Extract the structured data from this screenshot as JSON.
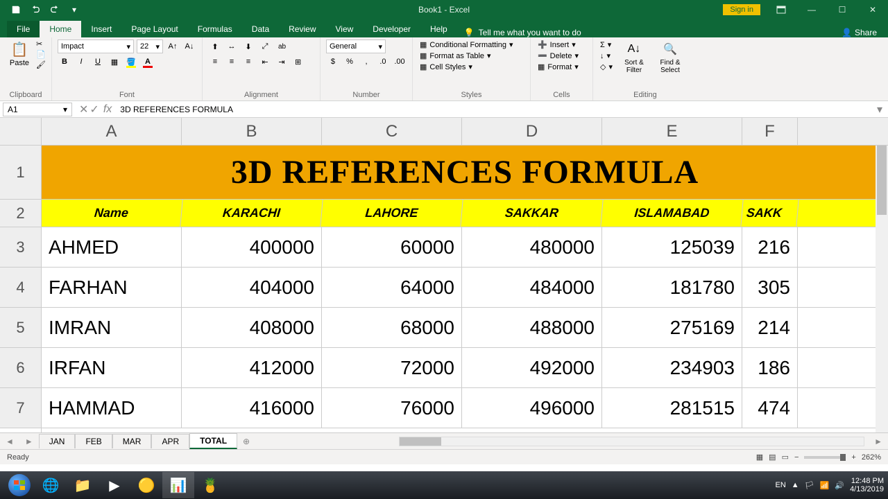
{
  "app": {
    "title": "Book1 - Excel"
  },
  "titlebar": {
    "signin": "Sign in"
  },
  "tabs": {
    "file": "File",
    "home": "Home",
    "insert": "Insert",
    "pagelayout": "Page Layout",
    "formulas": "Formulas",
    "data": "Data",
    "review": "Review",
    "view": "View",
    "developer": "Developer",
    "help": "Help",
    "tellme": "Tell me what you want to do",
    "share": "Share"
  },
  "ribbon": {
    "clipboard": {
      "paste": "Paste",
      "cut": "Cut",
      "copy": "Copy",
      "formatpainter": "Format Painter",
      "label": "Clipboard"
    },
    "font": {
      "name": "Impact",
      "size": "22",
      "label": "Font"
    },
    "alignment": {
      "wrap": "Wrap Text",
      "merge": "Merge & Center",
      "label": "Alignment"
    },
    "number": {
      "format": "General",
      "label": "Number"
    },
    "styles": {
      "cond": "Conditional Formatting",
      "table": "Format as Table",
      "cell": "Cell Styles",
      "label": "Styles"
    },
    "cells": {
      "insert": "Insert",
      "delete": "Delete",
      "format": "Format",
      "label": "Cells"
    },
    "editing": {
      "sort": "Sort & Filter",
      "find": "Find & Select",
      "label": "Editing"
    }
  },
  "namebox": "A1",
  "formula": "3D REFERENCES FORMULA",
  "columns": [
    "A",
    "B",
    "C",
    "D",
    "E",
    "F"
  ],
  "row_nums": [
    "1",
    "2",
    "3",
    "4",
    "5",
    "6",
    "7"
  ],
  "sheet_title": "3D REFERENCES FORMULA",
  "headers": [
    "Name",
    "KARACHI",
    "LAHORE",
    "SAKKAR",
    "ISLAMABAD",
    "SAKK"
  ],
  "rows": [
    {
      "name": "AHMED",
      "b": "400000",
      "c": "60000",
      "d": "480000",
      "e": "125039",
      "f": "216"
    },
    {
      "name": "FARHAN",
      "b": "404000",
      "c": "64000",
      "d": "484000",
      "e": "181780",
      "f": "305"
    },
    {
      "name": "IMRAN",
      "b": "408000",
      "c": "68000",
      "d": "488000",
      "e": "275169",
      "f": "214"
    },
    {
      "name": "IRFAN",
      "b": "412000",
      "c": "72000",
      "d": "492000",
      "e": "234903",
      "f": "186"
    },
    {
      "name": "HAMMAD",
      "b": "416000",
      "c": "76000",
      "d": "496000",
      "e": "281515",
      "f": "474"
    }
  ],
  "sheets": [
    "JAN",
    "FEB",
    "MAR",
    "APR",
    "TOTAL"
  ],
  "status": {
    "ready": "Ready",
    "zoom": "262%"
  },
  "tray": {
    "lang": "EN",
    "time": "12:48 PM",
    "date": "4/13/2019"
  }
}
